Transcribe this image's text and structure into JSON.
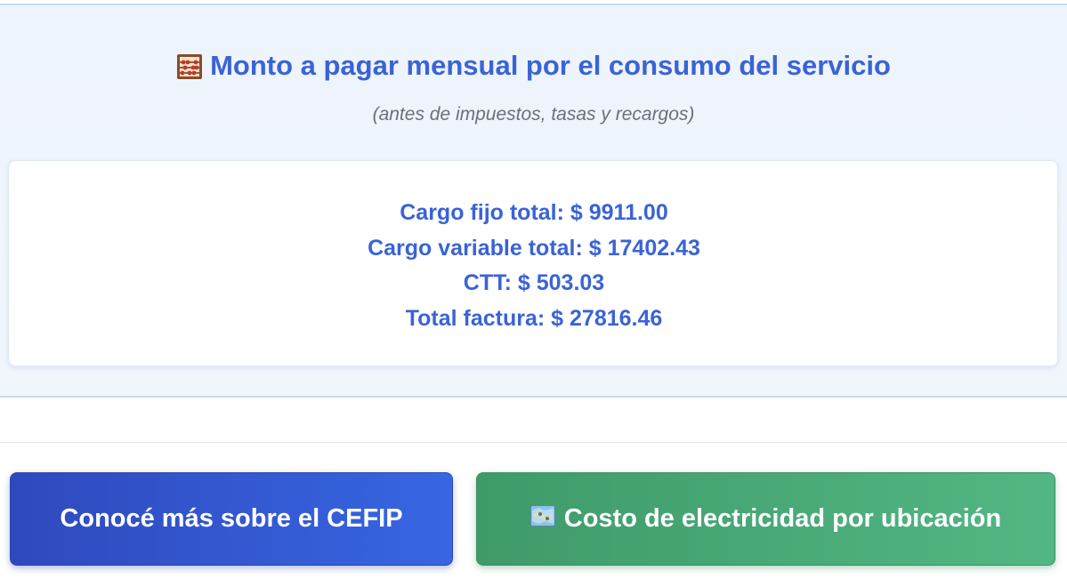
{
  "summary": {
    "icon": "abacus-icon",
    "title": "Monto a pagar mensual por el consumo del servicio",
    "subtitle": "(antes de impuestos, tasas y recargos)",
    "lines": [
      "Cargo fijo total: $ 9911.00",
      "Cargo variable total: $ 17402.43",
      "CTT: $ 503.03",
      "Total factura: $ 27816.46"
    ]
  },
  "buttons": {
    "cefip_label": "Conocé más sobre el CEFIP",
    "location_icon": "map-icon",
    "location_label": "Costo de electricidad por ubicación"
  },
  "colors": {
    "accent_blue": "#3a63d6",
    "button_blue": "#3766e3",
    "button_green": "#52b784"
  }
}
